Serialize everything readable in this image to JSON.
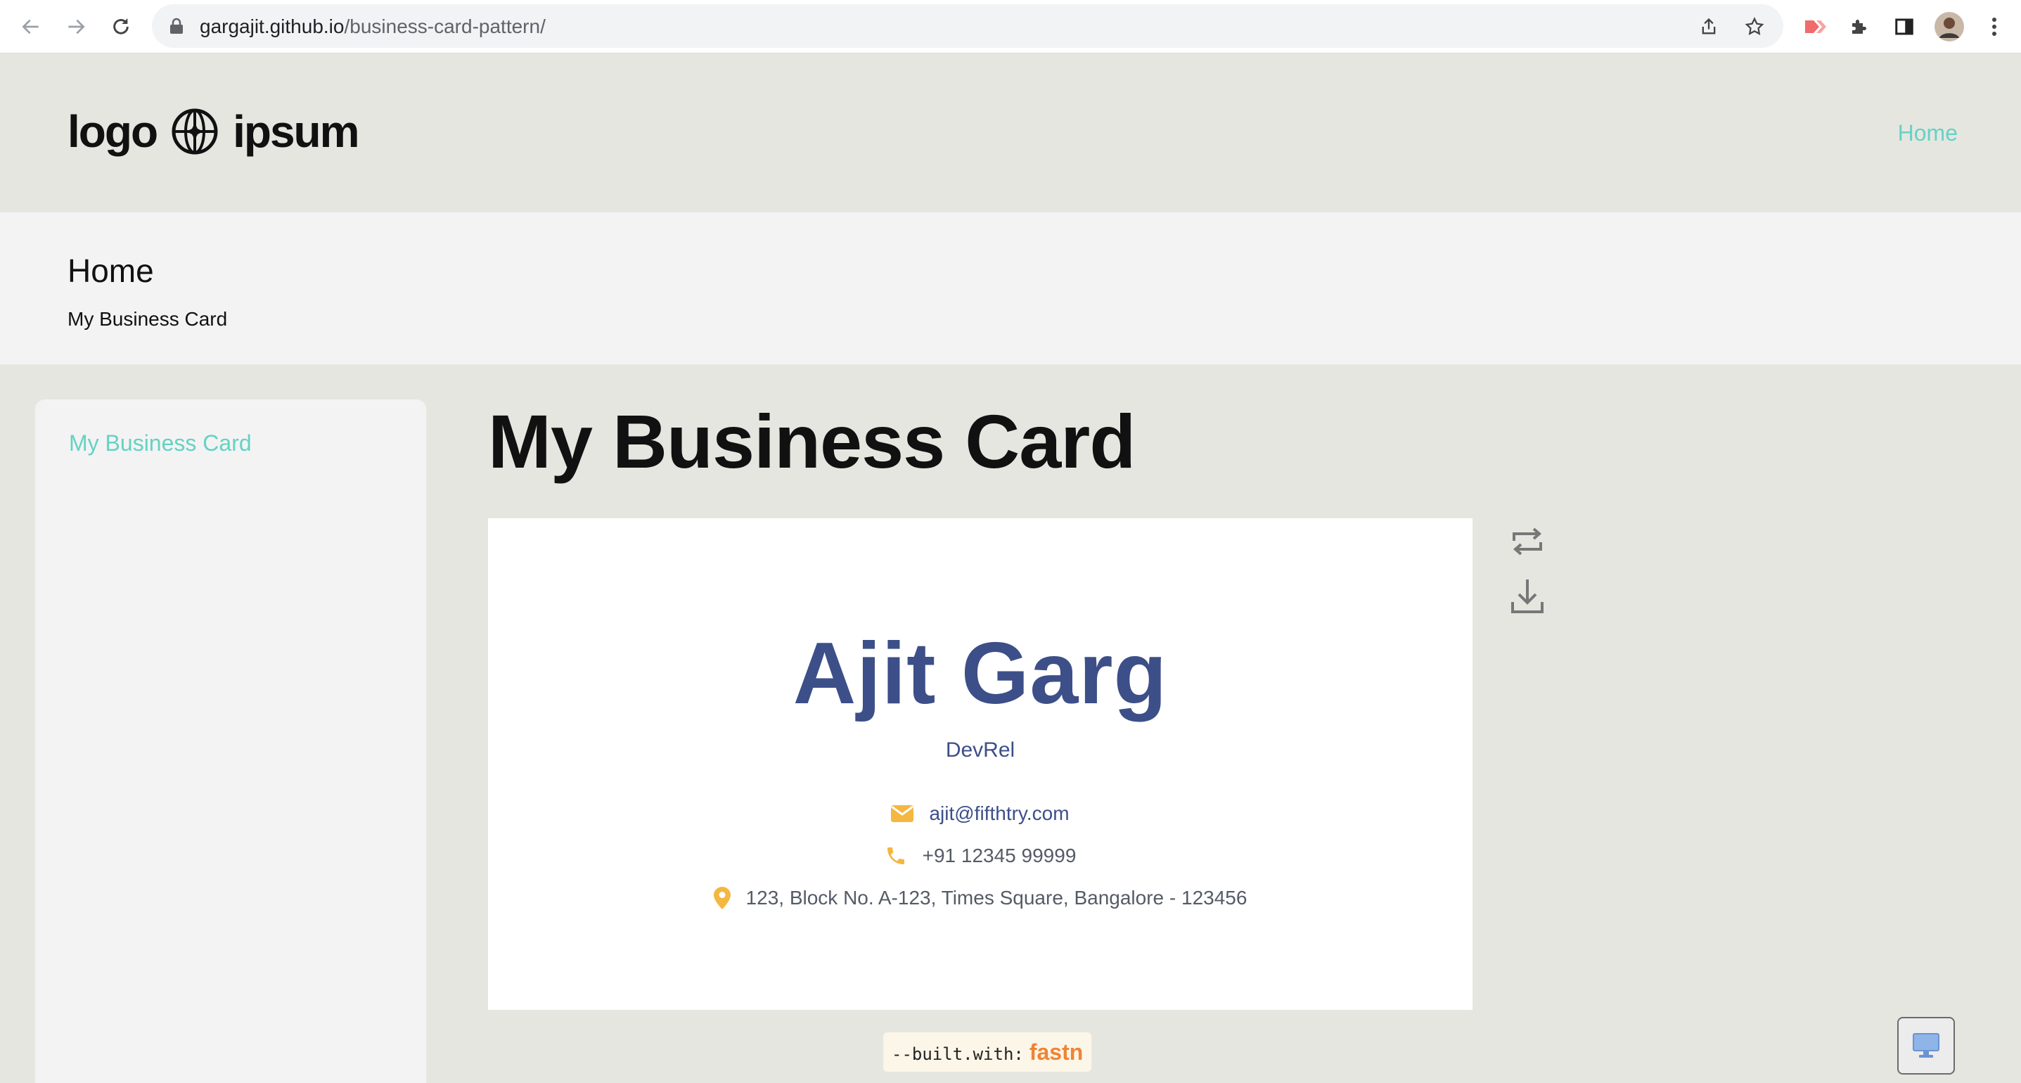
{
  "browser": {
    "url_domain": "gargajit.github.io",
    "url_path": "/business-card-pattern/",
    "icons": [
      "back-icon",
      "forward-icon",
      "reload-icon",
      "lock-icon",
      "share-icon",
      "bookmark-star-icon",
      "extension-red-icon",
      "puzzle-icon",
      "side-panel-icon",
      "profile-avatar",
      "menu-dots-icon"
    ]
  },
  "header": {
    "logo_left": "logo",
    "logo_right": "ipsum",
    "nav_home": "Home"
  },
  "breadcrumb": {
    "title": "Home",
    "subtitle": "My Business Card"
  },
  "sidebar": {
    "items": [
      {
        "label": "My Business Card",
        "active": true
      }
    ]
  },
  "main": {
    "title": "My Business Card",
    "card": {
      "name": "Ajit Garg",
      "role": "DevRel",
      "email": "ajit@fifthtry.com",
      "phone": "+91 12345 99999",
      "address": "123, Block No. A-123, Times Square, Bangalore - 123456"
    },
    "tools": [
      "flip-icon",
      "download-icon"
    ]
  },
  "footer": {
    "built_prefix": "--built.with:",
    "built_brand": "fastn"
  },
  "colors": {
    "accent": "#65d2c4",
    "card_text": "#3d4f88",
    "icon_yellow": "#f4b740",
    "brand_orange": "#ef8435"
  }
}
